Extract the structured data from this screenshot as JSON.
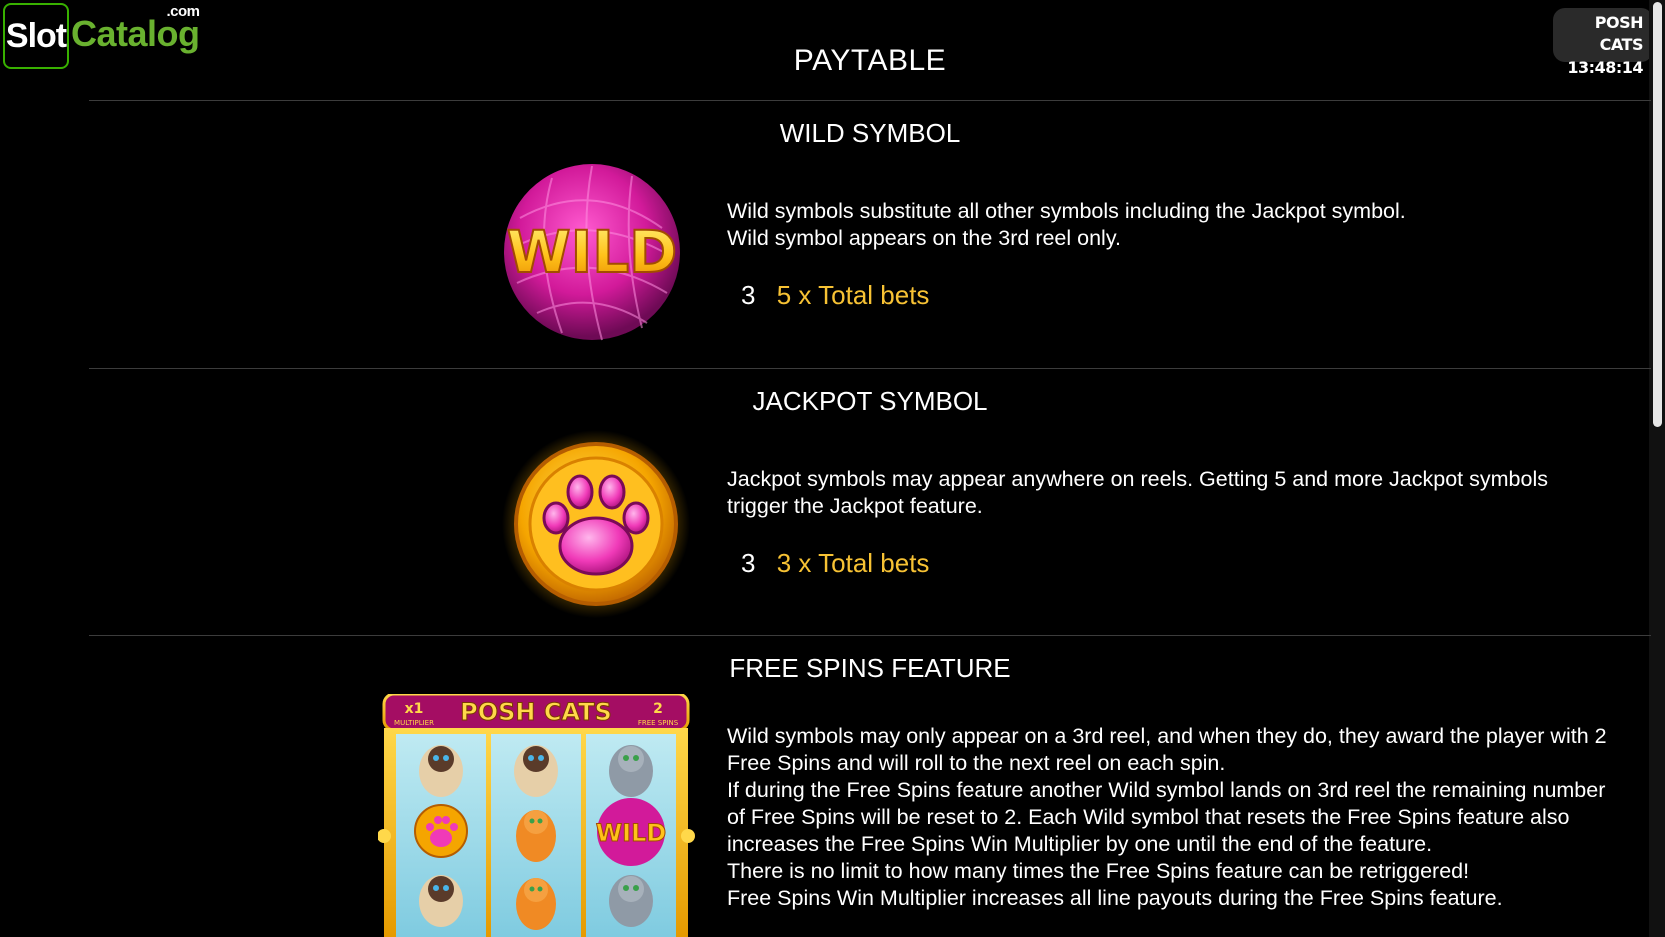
{
  "logo": {
    "box_text": "Slot",
    "text": "Catalog",
    "dotcom": ".com"
  },
  "badge": {
    "game_name": "POSH CATS",
    "time": "13:48:14"
  },
  "page_title": "PAYTABLE",
  "wild": {
    "title": "WILD SYMBOL",
    "symbol_text": "WILD",
    "lines": [
      "Wild symbols substitute all other symbols including the Jackpot symbol.",
      "Wild symbol appears on the 3rd reel only."
    ],
    "pay_count": "3",
    "pay_amount": "5 x Total bets"
  },
  "jackpot": {
    "title": "JACKPOT SYMBOL",
    "lines": [
      "Jackpot symbols may appear anywhere on reels. Getting 5 and more Jackpot symbols",
      "trigger the Jackpot feature."
    ],
    "pay_count": "3",
    "pay_amount": "3 x Total bets"
  },
  "free_spins": {
    "title": "FREE SPINS FEATURE",
    "reel_header": {
      "multiplier": "x1",
      "multiplier_label": "MULTIPLIER",
      "logo": "POSH CATS",
      "spins": "2",
      "spins_label": "FREE SPINS"
    },
    "lines": [
      "Wild symbols may only appear on a 3rd reel, and when they do, they award the player with 2",
      "Free Spins and will roll to the next reel on each spin.",
      "If during the Free Spins feature another Wild symbol lands on 3rd reel the remaining number",
      "of Free Spins will be reset to 2. Each Wild symbol that resets the Free Spins feature also",
      "increases the Free Spins Win Multiplier by one until the end of the feature.",
      "There is no limit to how many times the Free Spins feature can be retriggered!",
      "Free Spins Win Multiplier increases all line payouts during the Free Spins feature."
    ]
  },
  "colors": {
    "background": "#000000",
    "accent_gold": "#f7c234",
    "divider": "#3c3c3c",
    "logo_green": "#69b12f"
  }
}
